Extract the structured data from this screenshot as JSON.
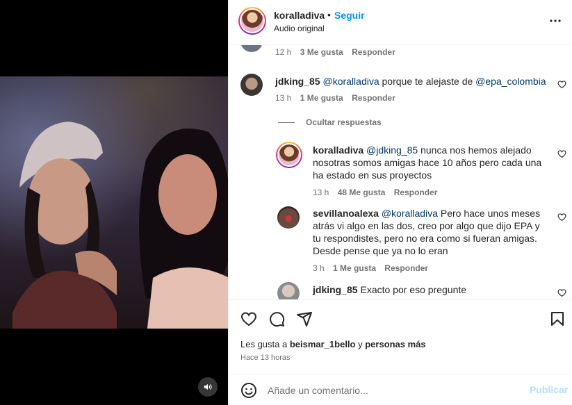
{
  "header": {
    "username": "koralladiva",
    "separator": "•",
    "follow_label": "Seguir",
    "audio": "Audio original"
  },
  "comments": [
    {
      "time": "12 h",
      "likes": "3 Me gusta",
      "reply": "Responder"
    },
    {
      "user": "jdking_85",
      "mention1": "@koralladiva",
      "text1": " porque te alejaste de ",
      "mention2": "@epa_colombia",
      "time": "13 h",
      "likes": "1 Me gusta",
      "reply": "Responder"
    }
  ],
  "hide_replies": "Ocultar respuestas",
  "replies": [
    {
      "user": "koralladiva",
      "mention": "@jdking_85",
      "text": " nunca nos hemos alejado nosotras somos amigas hace 10 años pero cada una ha estado en sus proyectos",
      "time": "13 h",
      "likes": "48 Me gusta",
      "reply": "Responder"
    },
    {
      "user": "sevillanoalexa",
      "mention": "@koralladiva",
      "text": " Pero hace unos meses atrás vi algo en las dos, creo por algo que dijo EPA y tu respondistes, pero no era como si fueran amigas. Desde pense que ya no lo eran",
      "time": "3 h",
      "likes": "1 Me gusta",
      "reply": "Responder"
    },
    {
      "user": "jdking_85",
      "text": " Exacto por eso pregunte"
    }
  ],
  "likes_line": {
    "prefix": "Les gusta a ",
    "user": "beismar_1bello",
    "middle": " y ",
    "rest": "personas más"
  },
  "posted": "Hace 13 horas",
  "comment_box": {
    "placeholder": "Añade un comentario...",
    "publish_label": "Publicar"
  },
  "icons": [
    "heart-icon",
    "comment-icon",
    "share-icon",
    "bookmark-icon",
    "emoji-icon",
    "more-icon",
    "volume-icon"
  ],
  "colors": {
    "accent": "#0095f6",
    "mention": "#00376b",
    "muted": "#737373",
    "publish_disabled": "#b2dffc"
  }
}
